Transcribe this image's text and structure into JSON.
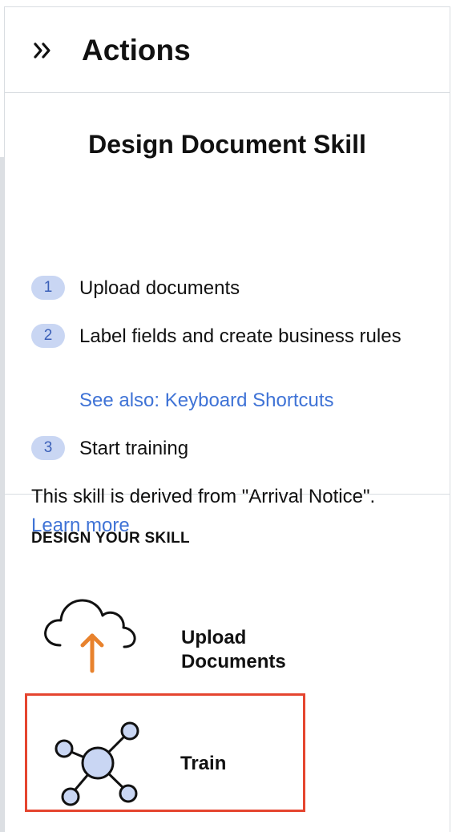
{
  "header": {
    "title": "Actions",
    "collapse_icon": "double-chevron-right-icon"
  },
  "instructions": {
    "title": "Design Document Skill",
    "steps": [
      {
        "number": "1",
        "label": "Upload documents"
      },
      {
        "number": "2",
        "label": "Label fields and create business rules",
        "link": "See also: Keyboard Shortcuts"
      },
      {
        "number": "3",
        "label": "Start training"
      }
    ],
    "derived_text": "This skill is derived from \"Arrival Notice\".",
    "learn_more": "Learn more"
  },
  "design": {
    "heading": "DESIGN YOUR SKILL",
    "actions": [
      {
        "label": "Upload Documents",
        "icon": "cloud-upload-icon",
        "selected": false
      },
      {
        "label": "Train",
        "icon": "network-nodes-icon",
        "selected": true
      }
    ]
  },
  "colors": {
    "accent_link": "#3f73d6",
    "badge_bg": "#c9d6f3",
    "selection_border": "#e5452f",
    "upload_arrow": "#e8822d",
    "node_fill": "#c9d6f3"
  }
}
